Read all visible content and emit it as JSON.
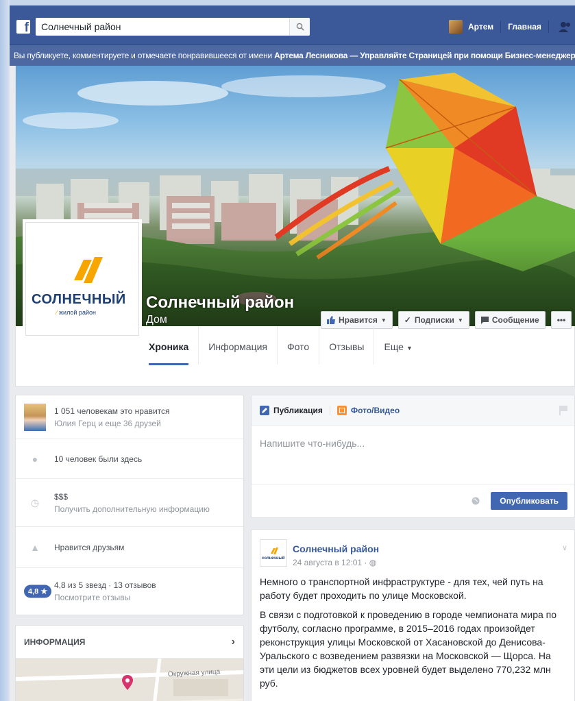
{
  "topbar": {
    "search_value": "Солнечный район",
    "user_name": "Артем",
    "home_label": "Главная"
  },
  "notice": {
    "text_before": "Вы публикуете, комментируете и отмечаете понравившееся от имени ",
    "user_bold": "Артема Лесникова",
    "text_after": " — Управляйте Страницей при помощи Бизнес-менеджера"
  },
  "page": {
    "name": "Солнечный район",
    "category": "Дом",
    "logo_text": "СОЛНЕЧНЫЙ",
    "logo_sub": "жилой район",
    "logo_small_text": "солнечный"
  },
  "actions": {
    "like": "Нравится",
    "follow": "Подписки",
    "message": "Сообщение",
    "more": "•••"
  },
  "tabs": [
    {
      "label": "Хроника"
    },
    {
      "label": "Информация"
    },
    {
      "label": "Фото"
    },
    {
      "label": "Отзывы"
    },
    {
      "label": "Еще"
    }
  ],
  "left": {
    "likes_text": "1 051 человекам это нравится",
    "likes_sub": "Юлия Герц и еще 36 друзей",
    "checkins": "10 человек были здесь",
    "price": "$$$",
    "price_sub": "Получить дополнительную информацию",
    "friends_like": "Нравится друзьям",
    "rating_badge": "4,8 ★",
    "rating_text": "4,8 из 5 звезд · 13 отзывов",
    "rating_sub": "Посмотрите отзывы",
    "info_header": "ИНФОРМАЦИЯ",
    "map_street": "Окружная улица"
  },
  "composer": {
    "tab_post": "Публикация",
    "tab_photo": "Фото/Видео",
    "placeholder": "Напишите что-нибудь...",
    "publish": "Опубликовать"
  },
  "post": {
    "author": "Солнечный район",
    "time": "24 августа в 12:01 · ",
    "p1": "Немного о транспортной инфраструктуре - для тех, чей путь на работу будет проходить по улице Московской.",
    "p2": "В связи с подготовкой к проведению в городе чемпионата мира по футболу, согласно программе, в 2015–2016 годах произойдет реконструкция улицы Московской от Хасановской до Денисова-Уральского с возведением развязки на Московской — Щорса. На эти цели из бюджетов всех уровней будет выделено 770,232 млн руб."
  },
  "colors": {
    "brand_blue": "#3b5998",
    "notice_blue": "#4e69a2",
    "button_blue": "#4267b2",
    "logo_orange": "#f7a600",
    "logo_navy": "#1d3f72"
  }
}
